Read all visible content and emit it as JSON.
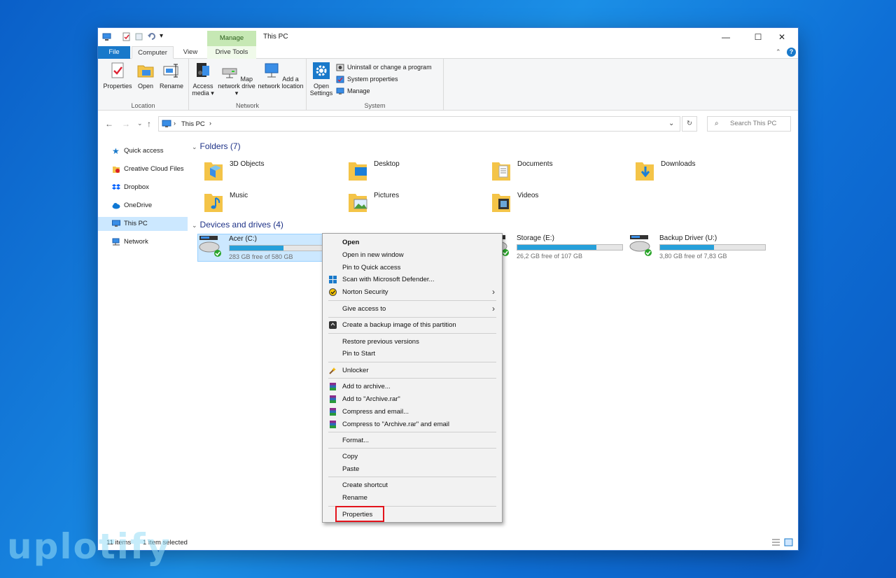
{
  "window": {
    "title": "This PC",
    "manage_tab": "Manage",
    "minimize": "—",
    "maximize": "☐",
    "close": "✕"
  },
  "tabs": {
    "file": "File",
    "computer": "Computer",
    "view": "View",
    "drive_tools": "Drive Tools"
  },
  "ribbon": {
    "location": {
      "label": "Location",
      "properties": "Properties",
      "open": "Open",
      "rename": "Rename"
    },
    "network": {
      "label": "Network",
      "access_media": "Access media ▾",
      "map_network_drive": "Map network drive ▾",
      "add_network_location": "Add a network location"
    },
    "system": {
      "label": "System",
      "open_settings": "Open Settings",
      "uninstall": "Uninstall or change a program",
      "system_properties": "System properties",
      "manage": "Manage"
    }
  },
  "address": {
    "path": "This PC",
    "search_placeholder": "Search This PC"
  },
  "sidebar": {
    "items": [
      {
        "label": "Quick access"
      },
      {
        "label": "Creative Cloud Files"
      },
      {
        "label": "Dropbox"
      },
      {
        "label": "OneDrive"
      },
      {
        "label": "This PC"
      },
      {
        "label": "Network"
      }
    ]
  },
  "folders": {
    "heading": "Folders (7)",
    "items": [
      {
        "label": "3D Objects"
      },
      {
        "label": "Desktop"
      },
      {
        "label": "Documents"
      },
      {
        "label": "Downloads"
      },
      {
        "label": "Music"
      },
      {
        "label": "Pictures"
      },
      {
        "label": "Videos"
      }
    ]
  },
  "drives": {
    "heading": "Devices and drives (4)",
    "items": [
      {
        "label": "Acer (C:)",
        "free": "283 GB free of 580 GB",
        "used_fraction": 0.51
      },
      {
        "label": "Storage (E:)",
        "free": "26,2 GB free of 107 GB",
        "used_fraction": 0.75
      },
      {
        "label": "Backup Driver (U:)",
        "free": "3,80 GB free of 7,83 GB",
        "used_fraction": 0.51
      }
    ]
  },
  "status": {
    "items": "11 items",
    "selected": "1 item selected"
  },
  "context_menu": {
    "open": "Open",
    "open_new_window": "Open in new window",
    "pin_quick_access": "Pin to Quick access",
    "scan_defender": "Scan with Microsoft Defender...",
    "norton": "Norton Security",
    "give_access": "Give access to",
    "backup_image": "Create a backup image of this partition",
    "restore_versions": "Restore previous versions",
    "pin_start": "Pin to Start",
    "unlocker": "Unlocker",
    "add_archive": "Add to archive...",
    "add_archive_rar": "Add to \"Archive.rar\"",
    "compress_email": "Compress and email...",
    "compress_rar_email": "Compress to \"Archive.rar\" and email",
    "format": "Format...",
    "copy": "Copy",
    "paste": "Paste",
    "create_shortcut": "Create shortcut",
    "rename": "Rename",
    "properties": "Properties"
  },
  "watermark": "uplotify"
}
